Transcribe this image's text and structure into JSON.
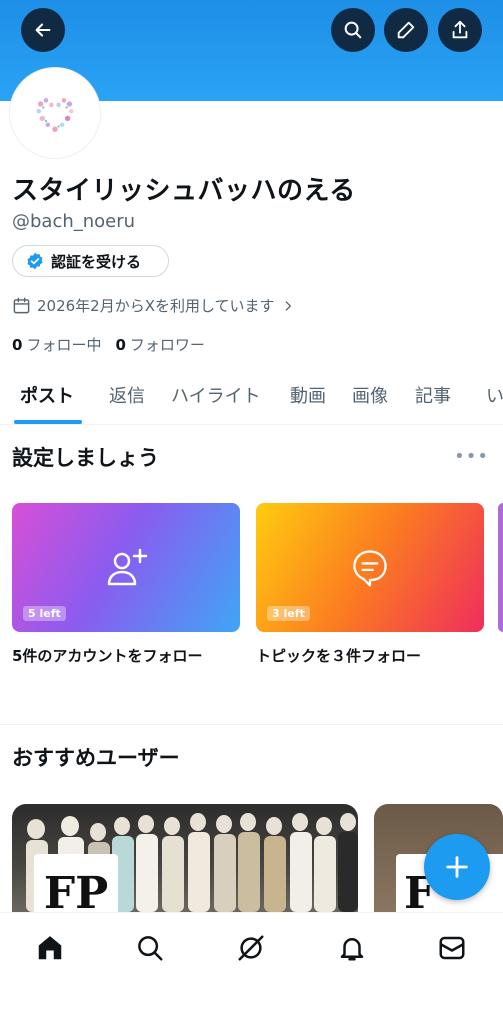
{
  "profile": {
    "display_name": "スタイリッシュバッハのえる",
    "handle": "@bach_noeru",
    "verify_label": "認証を受ける",
    "joined": "2026年2月からXを利用しています",
    "following_count": "0",
    "following_label": "フォロー中",
    "followers_count": "0",
    "followers_label": "フォロワー"
  },
  "tabs": [
    {
      "label": "ポスト"
    },
    {
      "label": "返信"
    },
    {
      "label": "ハイライト"
    },
    {
      "label": "動画"
    },
    {
      "label": "画像"
    },
    {
      "label": "記事"
    },
    {
      "label": "い"
    }
  ],
  "setup": {
    "title": "設定しましょう",
    "more": "•••",
    "cards": [
      {
        "badge": "5 left",
        "caption": "5件のアカウントをフォロー",
        "icon": "add-user-icon"
      },
      {
        "badge": "3 left",
        "caption": "トピックを３件フォロー",
        "icon": "topic-bubble-icon"
      }
    ]
  },
  "recommend": {
    "title": "おすすめユーザー",
    "logo_text": "FP"
  },
  "colors": {
    "accent": "#1d9bf0",
    "banner": "#1d8fe6",
    "header_button": "#102a44"
  },
  "nav": [
    "home-icon",
    "search-icon",
    "grok-icon",
    "notifications-icon",
    "messages-icon"
  ]
}
